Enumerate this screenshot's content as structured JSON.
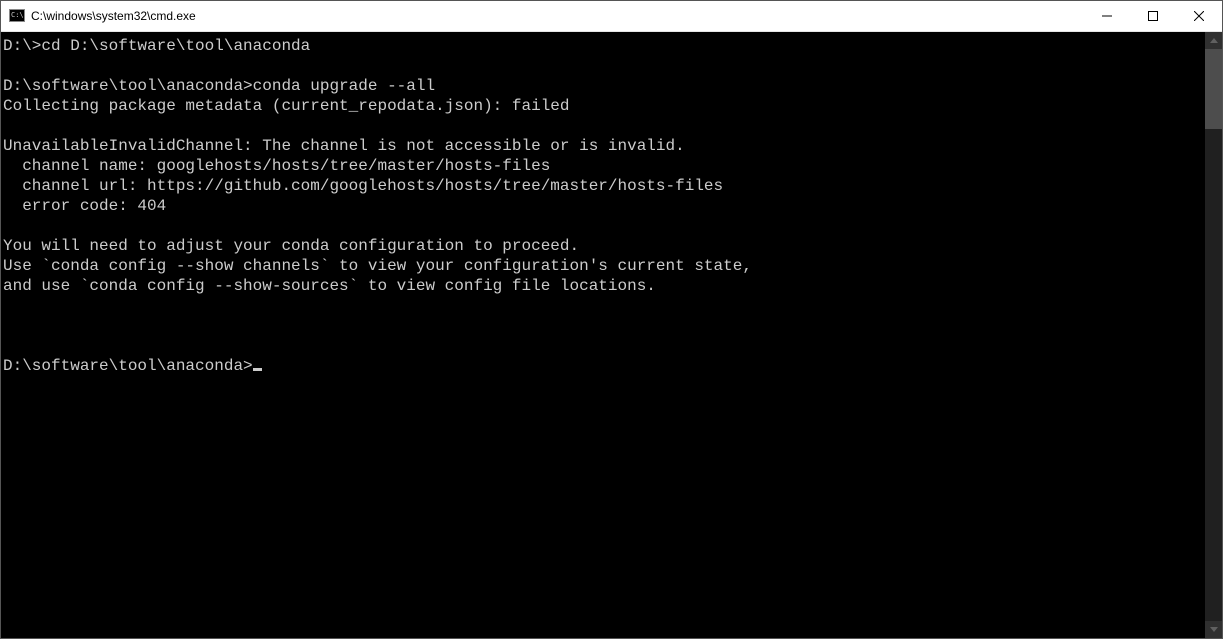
{
  "window": {
    "title": "C:\\windows\\system32\\cmd.exe"
  },
  "terminal": {
    "lines": [
      "D:\\>cd D:\\software\\tool\\anaconda",
      "",
      "D:\\software\\tool\\anaconda>conda upgrade --all",
      "Collecting package metadata (current_repodata.json): failed",
      "",
      "UnavailableInvalidChannel: The channel is not accessible or is invalid.",
      "  channel name: googlehosts/hosts/tree/master/hosts-files",
      "  channel url: https://github.com/googlehosts/hosts/tree/master/hosts-files",
      "  error code: 404",
      "",
      "You will need to adjust your conda configuration to proceed.",
      "Use `conda config --show channels` to view your configuration's current state,",
      "and use `conda config --show-sources` to view config file locations.",
      "",
      "",
      ""
    ],
    "prompt": "D:\\software\\tool\\anaconda>"
  }
}
